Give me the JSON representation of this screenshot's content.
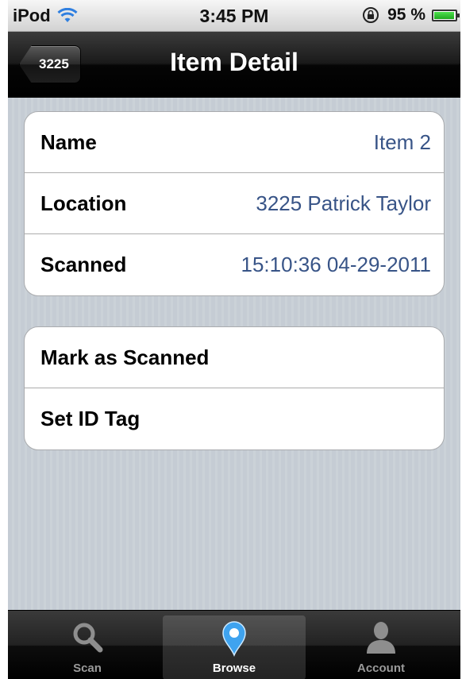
{
  "status_bar": {
    "device": "iPod",
    "time": "3:45 PM",
    "battery": "95 %",
    "battery_level": 0.95
  },
  "nav": {
    "back_label": "3225",
    "title": "Item Detail"
  },
  "detail_rows": [
    {
      "label": "Name",
      "value": "Item 2"
    },
    {
      "label": "Location",
      "value": "3225 Patrick Taylor"
    },
    {
      "label": "Scanned",
      "value": "15:10:36 04-29-2011"
    }
  ],
  "actions": [
    {
      "label": "Mark as Scanned"
    },
    {
      "label": "Set ID Tag"
    }
  ],
  "tabs": [
    {
      "label": "Scan",
      "icon": "magnifier-icon",
      "selected": false
    },
    {
      "label": "Browse",
      "icon": "map-pin-icon",
      "selected": true
    },
    {
      "label": "Account",
      "icon": "person-icon",
      "selected": false
    }
  ],
  "colors": {
    "value_text": "#385487",
    "wifi": "#2f7fe0",
    "selected_tab_icon": "#3fa3ef"
  }
}
